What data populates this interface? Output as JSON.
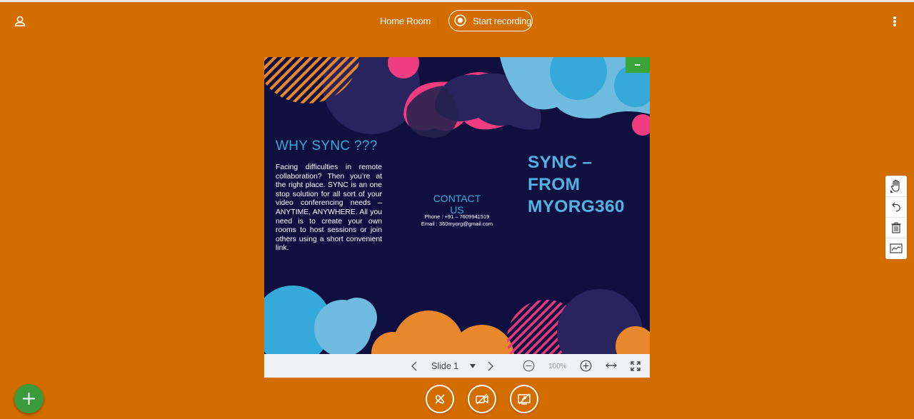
{
  "header": {
    "room_name": "Home Room",
    "record_label": "Start recording"
  },
  "slide": {
    "heading": "WHY SYNC ???",
    "body": "Facing difficulties in remote collaboration? Then you’re at the right place. SYNC is an one stop solution for all sort of your video conferencing needs – ANYTIME, ANYWHERE. All you need is to  create your own rooms to host sessions or join others using a short convenient link.",
    "contact_title": "CONTACT US",
    "phone": "Phone : +91 – 7609941519",
    "email": "Email : 360myorg@gmail.com",
    "brand_line1": "SYNC –",
    "brand_line2": "FROM",
    "brand_line3": "MYORG360"
  },
  "presentation_controls": {
    "slide_label": "Slide 1",
    "zoom_value": "100%"
  },
  "icons": {
    "user": "user-icon",
    "record": "record-icon",
    "more": "more-vertical-icon",
    "minimize": "minimize-icon",
    "prev": "chevron-left-icon",
    "dropdown": "caret-down-icon",
    "next": "chevron-right-icon",
    "zoom_out": "zoom-out-icon",
    "zoom_in": "zoom-in-icon",
    "fit_width": "fit-width-icon",
    "fullscreen": "fullscreen-icon",
    "hand": "hand-tool-icon",
    "undo": "undo-icon",
    "delete": "trash-icon",
    "whiteboard": "whiteboard-icon",
    "add": "plus-icon",
    "mute": "mic-off-icon",
    "camera": "camera-off-icon",
    "screenshare": "screenshare-off-icon"
  },
  "colors": {
    "background": "#d46d00",
    "slide_background": "#101040",
    "accent_blue": "#35a9d8",
    "pink": "#f0407a",
    "green_fab": "#3b9a3b"
  }
}
